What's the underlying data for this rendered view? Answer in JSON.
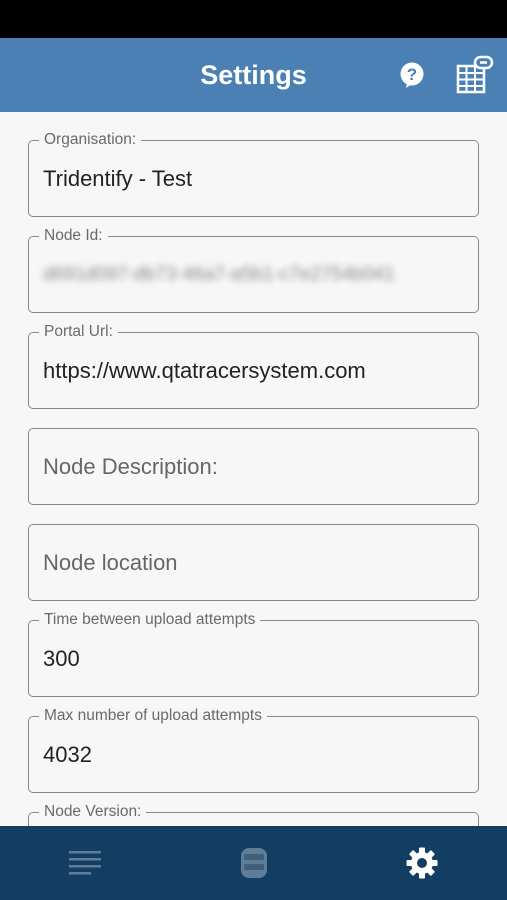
{
  "appbar": {
    "title": "Settings"
  },
  "fields": [
    {
      "label": "Organisation:",
      "value": "Tridentify - Test"
    },
    {
      "label": "Node Id:",
      "value": "d691d097-db73-46a7-a5b1-c7e2754b041"
    },
    {
      "label": "Portal Url:",
      "value": "https://www.qtatracersystem.com"
    },
    {
      "placeholder": "Node Description:"
    },
    {
      "placeholder": "Node location"
    },
    {
      "label": "Time between upload attempts",
      "value": "300"
    },
    {
      "label": "Max number of upload attempts",
      "value": "4032"
    },
    {
      "label": "Node Version:",
      "value": ""
    }
  ],
  "colors": {
    "appbar": "#4a80b4",
    "bottomnav": "#133e63",
    "background": "#f7f7f7"
  },
  "icons": {
    "help": "help-circle-icon",
    "scan": "calendar-link-icon",
    "list": "list-icon",
    "device": "device-icon",
    "settings": "gear-icon"
  }
}
